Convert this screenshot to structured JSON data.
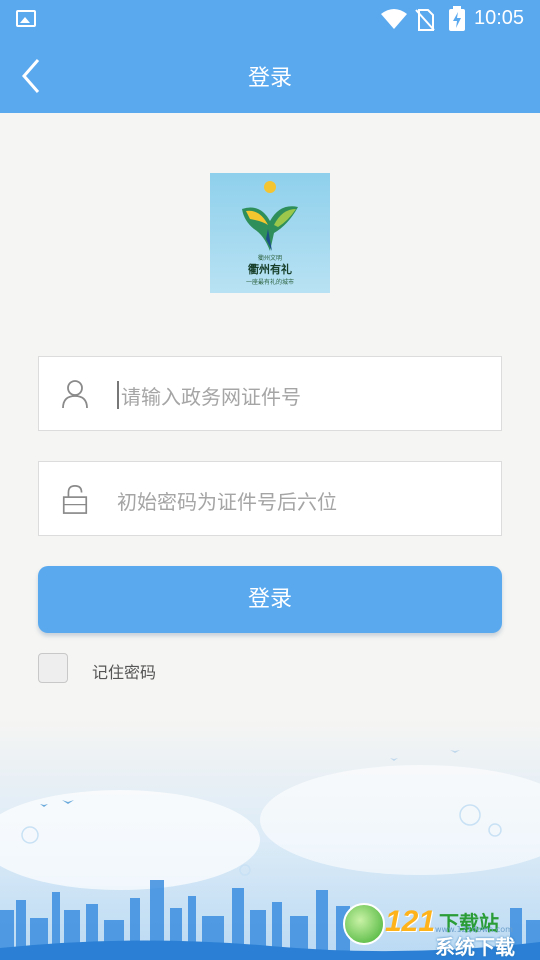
{
  "status_bar": {
    "time": "10:05"
  },
  "app_bar": {
    "title": "登录"
  },
  "logo": {
    "tag_small": "衢州文明",
    "brand": "衢州有礼",
    "slogan": "一座最有礼的城市"
  },
  "form": {
    "username_placeholder": "请输入政务网证件号",
    "password_placeholder": "初始密码为证件号后六位",
    "login_label": "登录",
    "remember_label": "记住密码",
    "remember_checked": false
  },
  "watermark": {
    "number": "121",
    "text_top": "下载站",
    "text_bottom": "系统下载",
    "url": "www.121down.com"
  },
  "colors": {
    "accent": "#5aa9ef",
    "background": "#f5f5f3",
    "placeholder": "#a5a5a5"
  }
}
